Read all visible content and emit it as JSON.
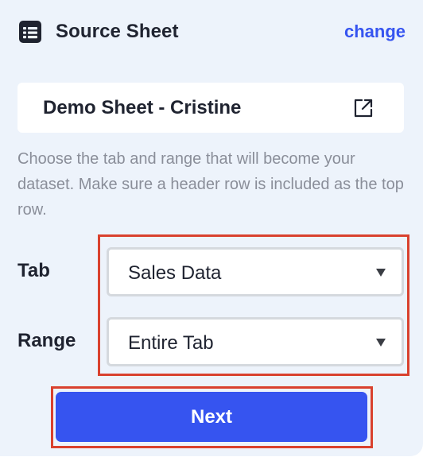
{
  "header": {
    "icon": "sheet-grid-icon",
    "title": "Source Sheet",
    "change_label": "change"
  },
  "sheet": {
    "name": "Demo Sheet - Cristine",
    "open_icon": "external-link-icon"
  },
  "description": "Choose the tab and range that will become your dataset. Make sure a header row is included as the top row.",
  "fields": {
    "tab": {
      "label": "Tab",
      "value": "Sales Data"
    },
    "range": {
      "label": "Range",
      "value": "Entire Tab"
    }
  },
  "next_label": "Next",
  "colors": {
    "accent": "#3654f0",
    "panel_background": "#edf3fb",
    "highlight": "#d9412e",
    "text": "#1f2330",
    "muted_text": "#8a8e99"
  }
}
